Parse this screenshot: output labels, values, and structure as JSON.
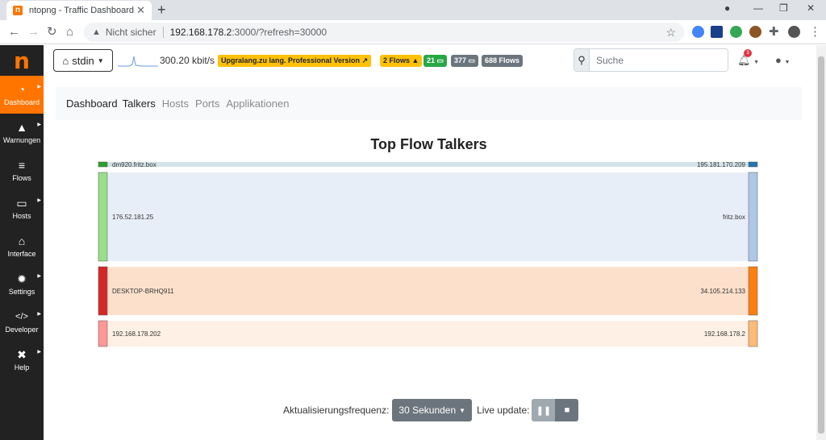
{
  "browser": {
    "tab_title": "ntopng - Traffic Dashboard",
    "tab_favicon": "n",
    "not_secure": "Nicht sicher",
    "url_host": "192.168.178.2",
    "url_path": ":3000/?refresh=30000"
  },
  "sidebar": {
    "logo": "n",
    "items": [
      {
        "label": "Dashboard",
        "icon": "gauge-icon",
        "glyph": "◔"
      },
      {
        "label": "Warnungen",
        "icon": "warning-icon",
        "glyph": "▲"
      },
      {
        "label": "Flows",
        "icon": "flows-icon",
        "glyph": "≡"
      },
      {
        "label": "Hosts",
        "icon": "laptop-icon",
        "glyph": "▭"
      },
      {
        "label": "Interface",
        "icon": "ethernet-icon",
        "glyph": "⌂"
      },
      {
        "label": "Settings",
        "icon": "gear-icon",
        "glyph": "✹"
      },
      {
        "label": "Developer",
        "icon": "code-icon",
        "glyph": "</>"
      },
      {
        "label": "Help",
        "icon": "help-icon",
        "glyph": "✖"
      }
    ]
  },
  "topnav": {
    "interface": "stdin",
    "rate": "300.20 kbit/s",
    "upgrade": "Upgralang.zu lang. Professional Version",
    "flows_warn": "2 Flows",
    "hosts_green": "21",
    "hosts_gray": "377",
    "flows_total": "688 Flows",
    "search_placeholder": "Suche",
    "alerts_count": "3"
  },
  "subnav": {
    "brand": "Dashboard",
    "active": "Talkers",
    "links": [
      "Hosts",
      "Ports",
      "Applikationen"
    ]
  },
  "chart_data": {
    "type": "sankey",
    "title": "Top Flow Talkers",
    "flows": [
      {
        "source": "dm920.fritz.box",
        "target": "195.181.170.209",
        "value": 3,
        "source_color": "#2ca02c",
        "target_color": "#1f77b4",
        "link_color": "#d4e3ea"
      },
      {
        "source": "176.52.181.25",
        "target": "fritz.box",
        "value": 55,
        "source_color": "#98df8a",
        "target_color": "#aec7e8",
        "link_color": "#e8eef8"
      },
      {
        "source": "DESKTOP-BRHQ911",
        "target": "34.105.214.133",
        "value": 30,
        "source_color": "#d62728",
        "target_color": "#ff7f0e",
        "link_color": "#fde0cc"
      },
      {
        "source": "192.168.178.202",
        "target": "192.168.178.2",
        "value": 16,
        "source_color": "#ff9896",
        "target_color": "#ffbb78",
        "link_color": "#fef0e4"
      }
    ]
  },
  "footer": {
    "freq_label": "Aktualisierungsfrequenz:",
    "freq_value": "30 Sekunden",
    "live_label": "Live update:"
  }
}
